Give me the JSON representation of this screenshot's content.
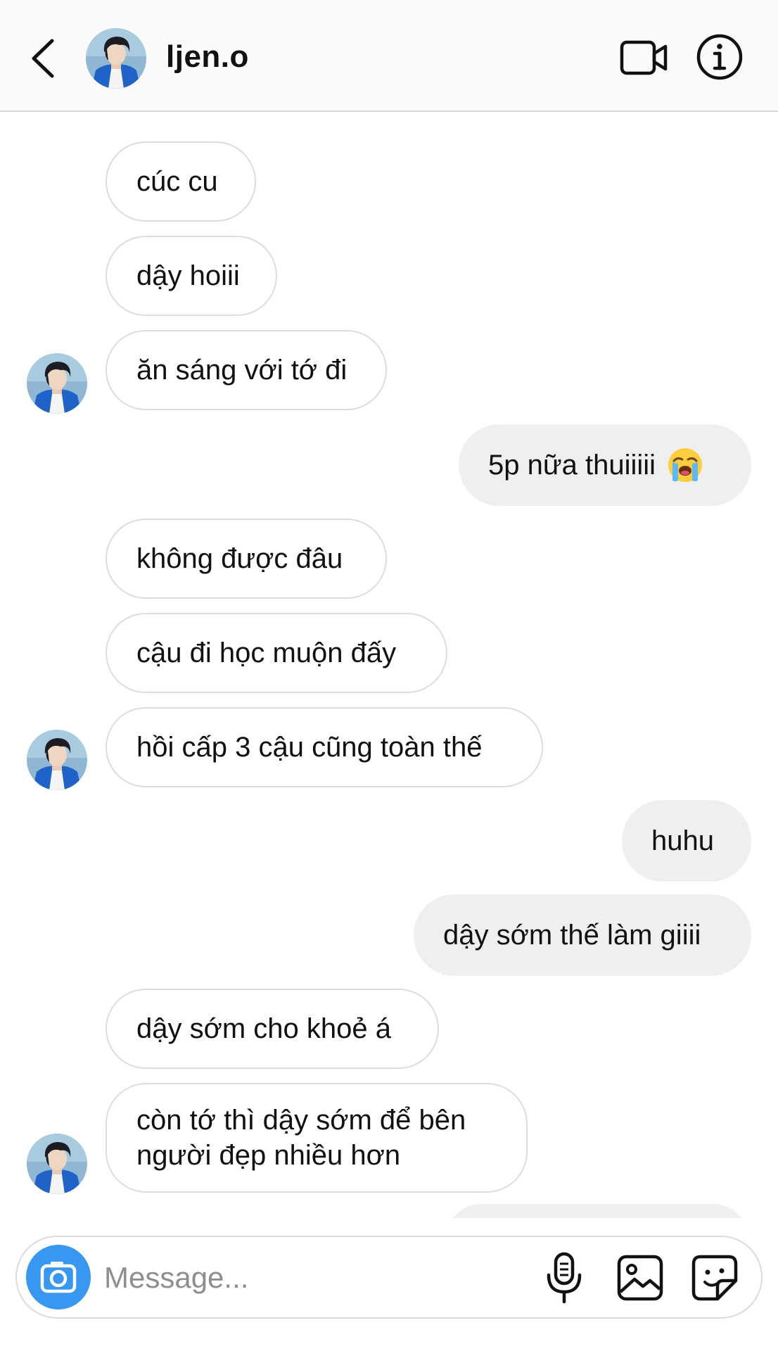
{
  "header": {
    "username": "ljen.o",
    "icons": {
      "back": "chevron-left-icon",
      "video": "video-camera-icon",
      "info": "info-icon"
    }
  },
  "messages": [
    {
      "side": "in",
      "text": "cúc cu"
    },
    {
      "side": "in",
      "text": "dậy hoiii"
    },
    {
      "side": "in",
      "text": "ăn sáng với tớ đi",
      "avatar": true
    },
    {
      "side": "out",
      "text": "5p nữa thuiiiii",
      "emoji": "loudly-crying-face-emoji"
    },
    {
      "side": "in",
      "text": "không được đâu"
    },
    {
      "side": "in",
      "text": "cậu đi học muộn đấy"
    },
    {
      "side": "in",
      "text": "hồi cấp 3 cậu cũng toàn thế",
      "avatar": true
    },
    {
      "side": "out",
      "text": "huhu"
    },
    {
      "side": "out",
      "text": "dậy sớm thế làm giiii"
    },
    {
      "side": "in",
      "text": "dậy sớm cho khoẻ á"
    },
    {
      "side": "in",
      "text": "còn tớ thì dậy sớm để bên người đẹp nhiều hơn",
      "avatar": true
    }
  ],
  "composer": {
    "placeholder": "Message...",
    "icons": {
      "camera": "camera-icon",
      "mic": "microphone-icon",
      "gallery": "gallery-icon",
      "sticker": "sticker-icon"
    }
  },
  "colors": {
    "header_bg": "#fafafa",
    "incoming_bubble_border": "#dddddd",
    "outgoing_bubble_bg": "#efefef",
    "camera_button": "#3897f0",
    "placeholder": "#8e8e8e"
  }
}
